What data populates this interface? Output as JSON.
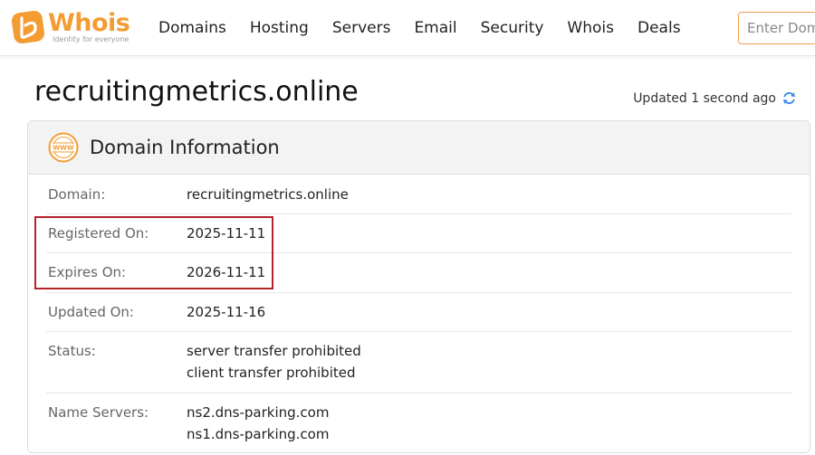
{
  "header": {
    "logo_text": "Whois",
    "logo_tagline": "Identity for everyone",
    "nav": [
      "Domains",
      "Hosting",
      "Servers",
      "Email",
      "Security",
      "Whois",
      "Deals"
    ],
    "search_placeholder": "Enter Domain"
  },
  "domain": {
    "name": "recruitingmetrics.online",
    "updated": "Updated 1 second ago"
  },
  "card": {
    "title": "Domain Information",
    "rows": [
      {
        "label": "Domain:",
        "values": [
          "recruitingmetrics.online"
        ]
      },
      {
        "label": "Registered On:",
        "values": [
          "2025-11-11"
        ]
      },
      {
        "label": "Expires On:",
        "values": [
          "2026-11-11"
        ]
      },
      {
        "label": "Updated On:",
        "values": [
          "2025-11-16"
        ]
      },
      {
        "label": "Status:",
        "values": [
          "server transfer prohibited",
          "client transfer prohibited"
        ]
      },
      {
        "label": "Name Servers:",
        "values": [
          "ns2.dns-parking.com",
          "ns1.dns-parking.com"
        ]
      }
    ]
  },
  "colors": {
    "brand_orange": "#f39c33",
    "highlight_red": "#b3232a",
    "refresh_blue": "#3a8ee6"
  }
}
